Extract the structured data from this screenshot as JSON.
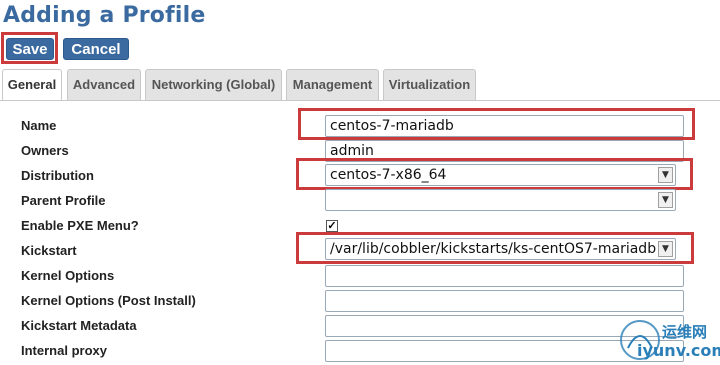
{
  "page": {
    "title": "Adding a Profile"
  },
  "buttons": {
    "save": "Save",
    "cancel": "Cancel"
  },
  "tabs": [
    {
      "label": "General",
      "active": true
    },
    {
      "label": "Advanced",
      "active": false
    },
    {
      "label": "Networking (Global)",
      "active": false
    },
    {
      "label": "Management",
      "active": false
    },
    {
      "label": "Virtualization",
      "active": false
    }
  ],
  "form": {
    "name": {
      "label": "Name",
      "value": "centos-7-mariadb"
    },
    "owners": {
      "label": "Owners",
      "value": "admin"
    },
    "distribution": {
      "label": "Distribution",
      "value": "centos-7-x86_64"
    },
    "parent_profile": {
      "label": "Parent Profile",
      "value": ""
    },
    "enable_pxe": {
      "label": "Enable PXE Menu?",
      "checked": true
    },
    "kickstart": {
      "label": "Kickstart",
      "value": "/var/lib/cobbler/kickstarts/ks-centOS7-mariadb"
    },
    "kernel_options": {
      "label": "Kernel Options",
      "value": ""
    },
    "kernel_options_post": {
      "label": "Kernel Options (Post Install)",
      "value": ""
    },
    "kickstart_metadata": {
      "label": "Kickstart Metadata",
      "value": ""
    },
    "internal_proxy": {
      "label": "Internal proxy",
      "value": ""
    }
  },
  "watermark": {
    "line1": "运维网",
    "line2": "iyunv.com"
  },
  "colors": {
    "accent": "#3a6aa0",
    "highlight": "#cc3b3b"
  }
}
